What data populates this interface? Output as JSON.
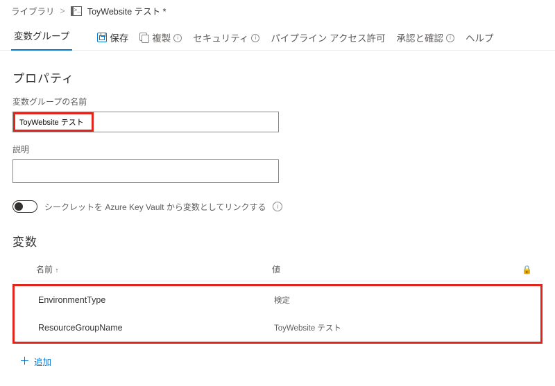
{
  "breadcrumb": {
    "root": "ライブラリ",
    "title": "ToyWebsite テスト *"
  },
  "toolbar": {
    "tab_label": "変数グループ",
    "save": "保存",
    "clone": "複製",
    "security": "セキュリティ",
    "pipeline_perms": "パイプライン アクセス許可",
    "approvals": "承認と確認",
    "help": "ヘルプ"
  },
  "props": {
    "section": "プロパティ",
    "name_label": "変数グループの名前",
    "name_value": "ToyWebsite テスト",
    "desc_label": "説明",
    "desc_value": "",
    "kv_toggle": "シークレットを Azure Key Vault から変数としてリンクする"
  },
  "vars": {
    "section": "変数",
    "col_name": "名前",
    "col_value": "値",
    "rows": [
      {
        "name": "EnvironmentType",
        "value": "検定"
      },
      {
        "name": "ResourceGroupName",
        "value": "ToyWebsite テスト"
      }
    ],
    "add": "追加"
  }
}
